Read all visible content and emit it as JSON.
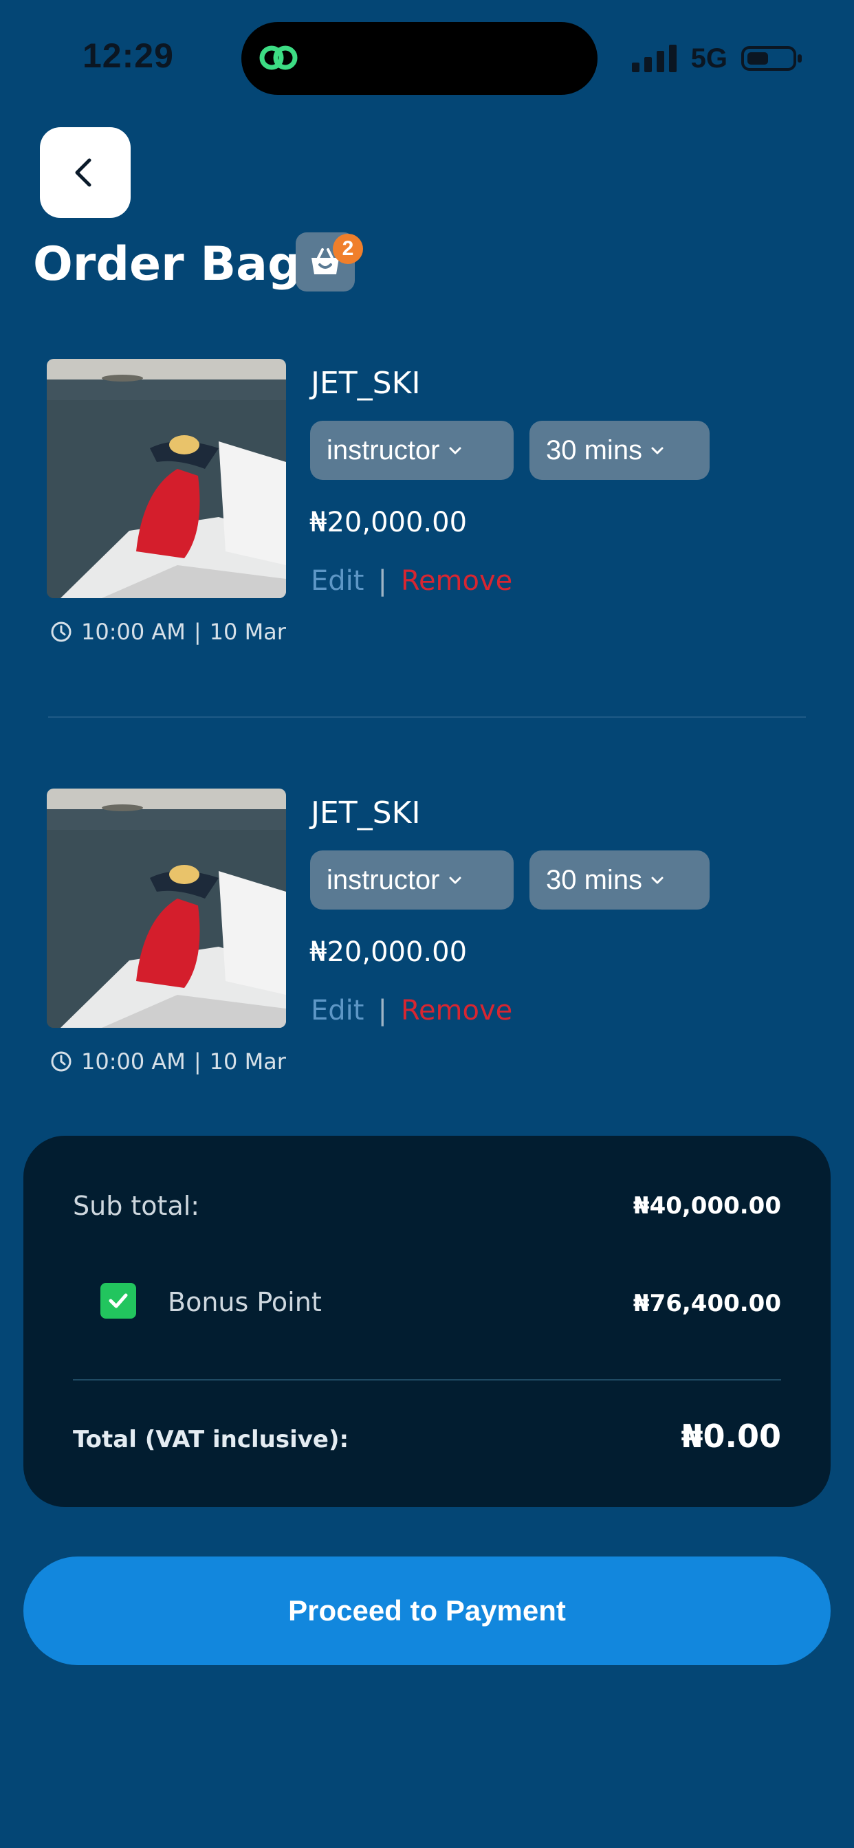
{
  "status_bar": {
    "time": "12:29",
    "network": "5G"
  },
  "header": {
    "title": "Order Bag",
    "bag_count": "2"
  },
  "items": [
    {
      "name": "JET_SKI",
      "option": "instructor",
      "duration": "30 mins",
      "price": "₦20,000.00",
      "edit_label": "Edit",
      "separator": "|",
      "remove_label": "Remove",
      "time": "10:00 AM",
      "date_separator": "|",
      "date": "10 Mar"
    },
    {
      "name": "JET_SKI",
      "option": "instructor",
      "duration": "30 mins",
      "price": "₦20,000.00",
      "edit_label": "Edit",
      "separator": "|",
      "remove_label": "Remove",
      "time": "10:00 AM",
      "date_separator": "|",
      "date": "10 Mar"
    }
  ],
  "summary": {
    "subtotal_label": "Sub total:",
    "subtotal_value": "₦40,000.00",
    "bonus_label": "Bonus Point",
    "bonus_value": "₦76,400.00",
    "bonus_checked": true,
    "total_label": "Total (VAT inclusive):",
    "total_value": "₦0.00"
  },
  "cta": {
    "label": "Proceed to Payment"
  },
  "colors": {
    "background": "#044675",
    "card": "#021d30",
    "accent": "#1287dd",
    "remove": "#d72631",
    "edit": "#5e97c6",
    "badge": "#f07f2b",
    "check": "#22c55e"
  }
}
